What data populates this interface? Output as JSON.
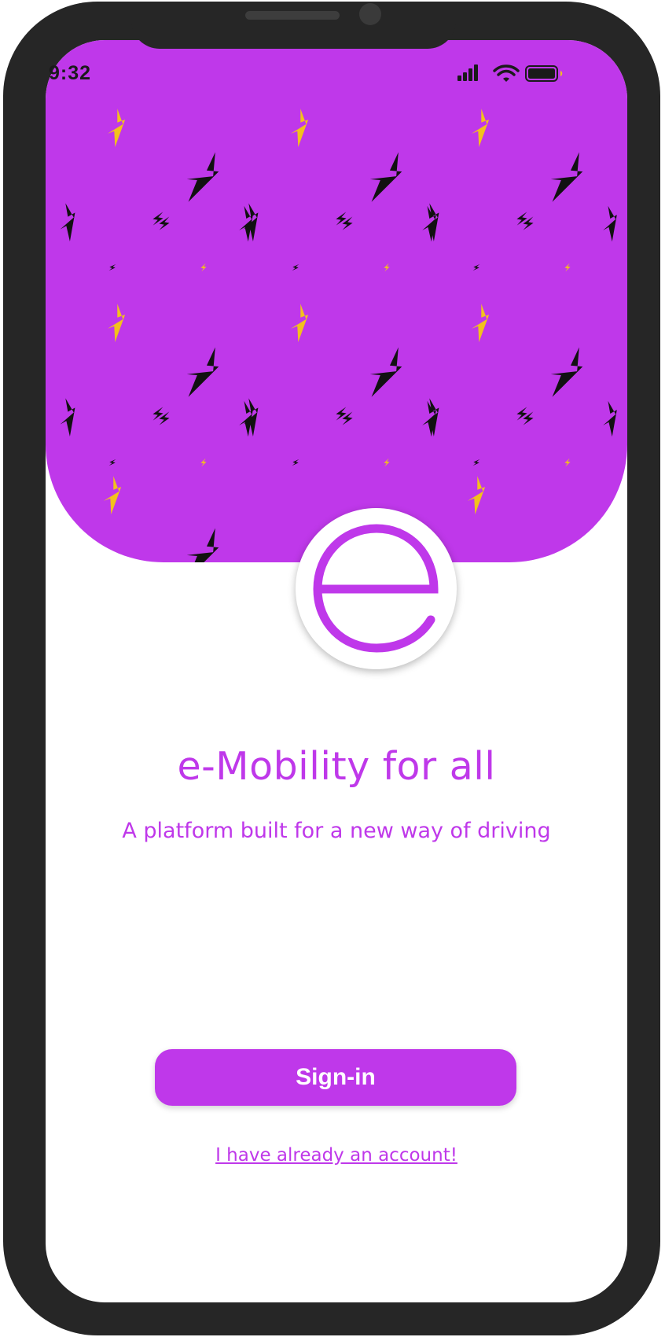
{
  "status_bar": {
    "time": "9:32"
  },
  "hero": {
    "background_color": "#bf38ea",
    "pattern_icon": "lightning-bolt-icon",
    "pattern_colors": [
      "#111111",
      "#f2c11d"
    ]
  },
  "logo": {
    "letter": "e",
    "color": "#bf38ea"
  },
  "welcome": {
    "headline": "e-Mobility for all",
    "subheadline": "A platform built for a new way of driving"
  },
  "actions": {
    "signin_label": "Sign-in",
    "account_link_label": "I have already an account!"
  },
  "theme": {
    "accent": "#bf38ea",
    "device_frame": "#262626"
  }
}
